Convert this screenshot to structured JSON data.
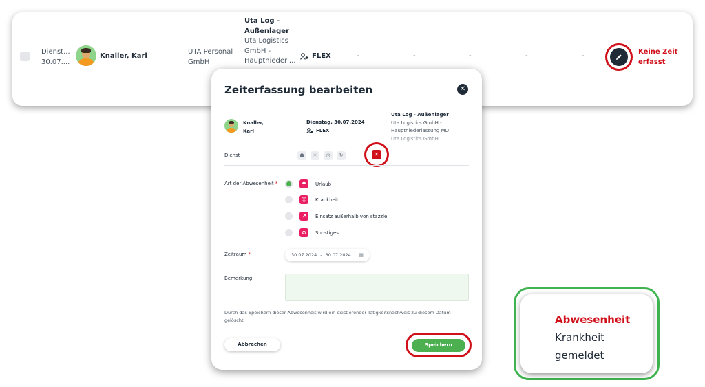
{
  "row": {
    "dienst_label": "Dienst...",
    "date_short": "30.07....",
    "name": "Knaller, Karl",
    "company_line1": "UTA Personal",
    "company_line2": "GmbH",
    "site_title_line1": "Uta Log -",
    "site_title_line2": "Außenlager",
    "site_line1": "Uta Logistics",
    "site_line2": "GmbH -",
    "site_line3": "Hauptniederl...",
    "shift_label": "FLEX",
    "empty_values": [
      "-",
      "-",
      "-",
      "-",
      "-"
    ],
    "status_line1": "Keine Zeit",
    "status_line2": "erfasst"
  },
  "modal": {
    "title": "Zeiterfassung bearbeiten",
    "employee_line1": "Knaller,",
    "employee_line2": "Karl",
    "date": "Dienstag, 30.07.2024",
    "shift": "FLEX",
    "site_title": "Uta Log - Außenlager",
    "site_line1": "Uta Logistics GmbH -",
    "site_line2": "Hauptniederlassung MD",
    "site_line3": "Uta Logistics GmbH",
    "dienst_label": "Dienst",
    "absence_label": "Art der Abwesenheit",
    "required_mark": "*",
    "options": [
      "Urlaub",
      "Krankheit",
      "Einsatz außerhalb von stazzle",
      "Sonstiges"
    ],
    "period_label": "Zeitraum",
    "period_from": "30.07.2024",
    "period_sep": "-",
    "period_to": "30.07.2024",
    "remark_label": "Bemerkung",
    "notice": "Durch das Speichern dieser Abwesenheit wird ein existierender Tätigkeitsnachweis zu diesem Datum gelöscht.",
    "cancel_label": "Abbrechen",
    "save_label": "Speichern"
  },
  "callout": {
    "line1": "Abwesenheit",
    "line2": "Krankheit",
    "line3": "gemeldet"
  },
  "colors": {
    "accent_red": "#d0101a",
    "accent_green": "#4caf50",
    "option_pink": "#e91e63",
    "dark": "#1f2a37"
  },
  "icons": [
    "user-icon",
    "pencil-icon",
    "close-icon",
    "person-icon",
    "sun-icon",
    "clock-icon",
    "refresh-icon",
    "x-icon",
    "umbrella-icon",
    "sick-icon",
    "external-icon",
    "prohibited-icon",
    "calendar-icon"
  ]
}
